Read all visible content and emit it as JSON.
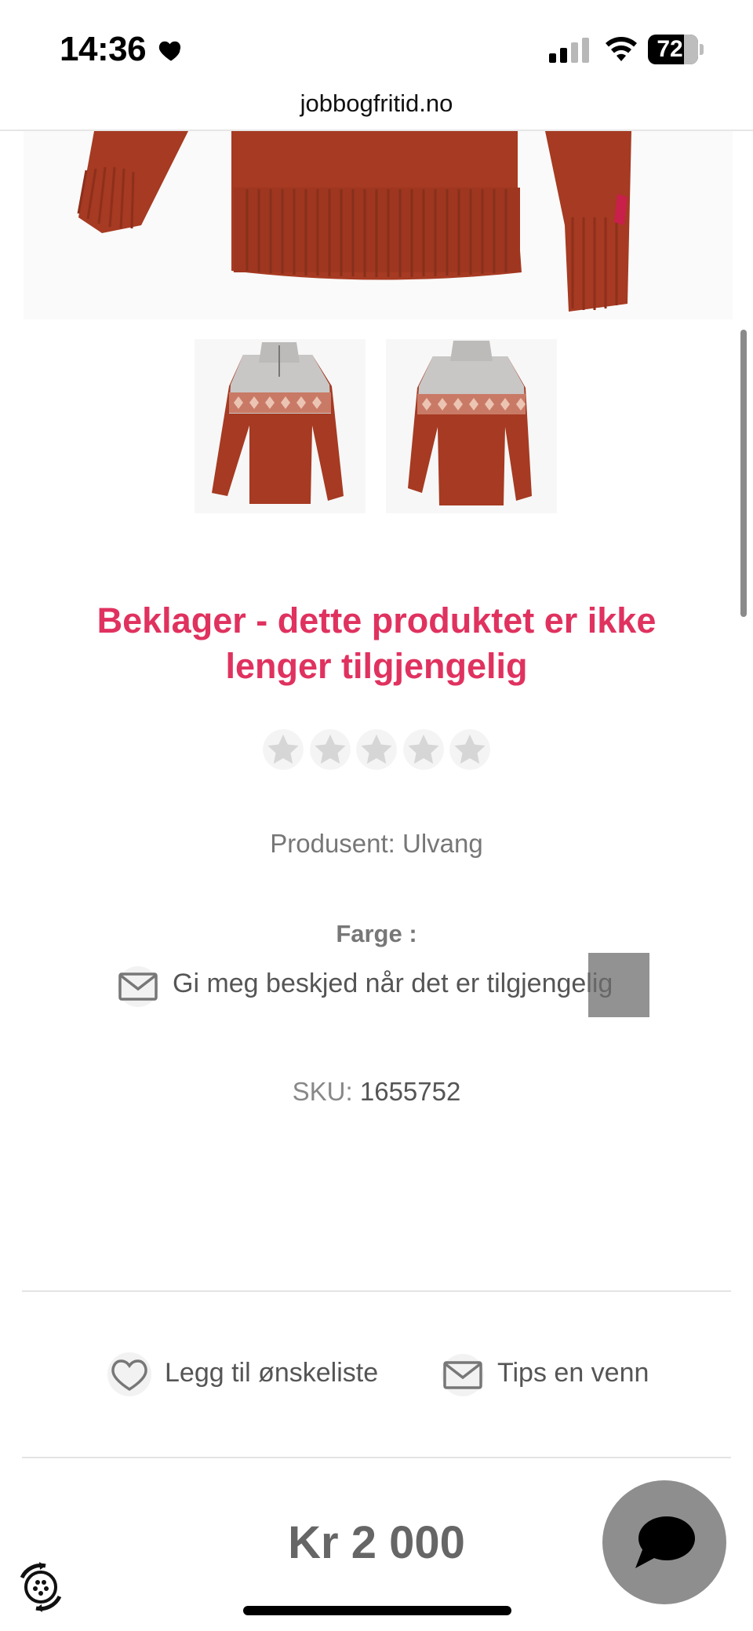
{
  "status_bar": {
    "time": "14:36",
    "battery": "72"
  },
  "browser": {
    "url": "jobbogfritid.no"
  },
  "product": {
    "unavailable_message": "Beklager - dette produktet er ikke lenger tilgjengelig",
    "rating_stars": 5,
    "rating_value": 0,
    "manufacturer_label": "Produsent:",
    "manufacturer": "Ulvang",
    "color_label": "Farge :",
    "notify_text": "Gi meg beskjed når det er tilgjengelig",
    "sku_label": "SKU:",
    "sku": "1655752",
    "price": "Kr 2 000",
    "colors": {
      "sweater_body": "#a63a22",
      "sweater_yoke": "#c9c7c6",
      "pattern": "#e7b7a4",
      "accent": "#e0325f"
    }
  },
  "actions": {
    "wishlist_label": "Legg til ønskeliste",
    "tips_label": "Tips en venn"
  },
  "icons": {
    "heart_status": "heart-icon",
    "notify": "envelope-icon",
    "wishlist": "heart-outline-icon",
    "tips": "envelope-icon",
    "chat": "chat-bubble-icon",
    "accessibility": "accessibility-icon"
  }
}
